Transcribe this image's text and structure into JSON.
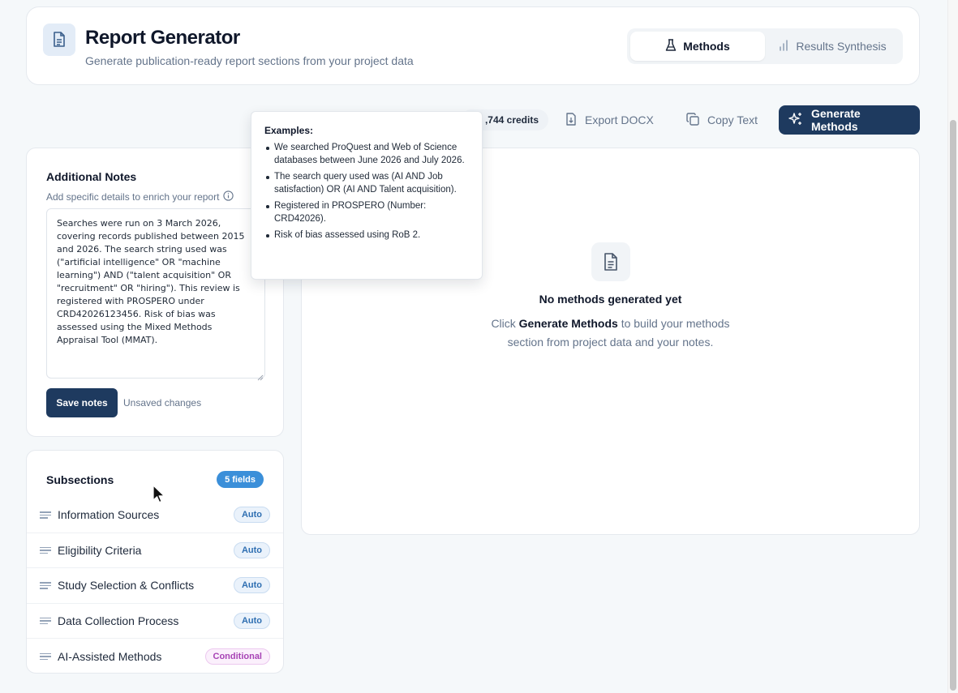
{
  "header": {
    "app_icon": "document-icon",
    "title": "Report Generator",
    "subtitle": "Generate publication-ready report sections from your project data",
    "tabs": [
      {
        "label": "Methods",
        "icon": "flask-icon",
        "active": true
      },
      {
        "label": "Results Synthesis",
        "icon": "bar-chart-icon",
        "active": false
      }
    ]
  },
  "toolbar": {
    "credits": ",744 credits",
    "export_label": "Export DOCX",
    "copy_label": "Copy Text",
    "generate_label": "Generate Methods"
  },
  "notes": {
    "title": "Additional Notes",
    "hint": "Add specific details to enrich your report",
    "value": "Searches were run on 3 March 2026, covering records published between 2015 and 2026. The search string used was (\"artificial intelligence\" OR \"machine learning\") AND (\"talent acquisition\" OR \"recruitment\" OR \"hiring\"). This review is registered with PROSPERO under CRD42026123456. Risk of bias was assessed using the Mixed Methods Appraisal Tool (MMAT).",
    "save_label": "Save notes",
    "status": "Unsaved changes"
  },
  "subsections": {
    "title": "Subsections",
    "count_badge": "5 fields",
    "items": [
      {
        "label": "Information Sources",
        "badge": "Auto"
      },
      {
        "label": "Eligibility Criteria",
        "badge": "Auto"
      },
      {
        "label": "Study Selection & Conflicts",
        "badge": "Auto"
      },
      {
        "label": "Data Collection Process",
        "badge": "Auto"
      },
      {
        "label": "AI-Assisted Methods",
        "badge": "Conditional"
      }
    ]
  },
  "empty_state": {
    "title": "No methods generated yet",
    "desc_prefix": "Click ",
    "desc_bold": "Generate Methods",
    "desc_suffix_line1": " to build your methods",
    "desc_line2": "section from project data and your notes."
  },
  "tooltip": {
    "title": "Examples:",
    "items": [
      "We searched ProQuest and Web of Science databases between June 2026 and July 2026.",
      "The search query used was (AI AND Job satisfaction) OR (AI AND Talent acquisition).",
      "Registered in PROSPERO (Number: CRD42026).",
      "Risk of bias assessed using RoB 2."
    ]
  },
  "colors": {
    "primary": "#1e3a5f",
    "count_badge": "#3b8fd9",
    "auto_badge": "#2f6fb2",
    "conditional_badge": "#a743b5"
  }
}
